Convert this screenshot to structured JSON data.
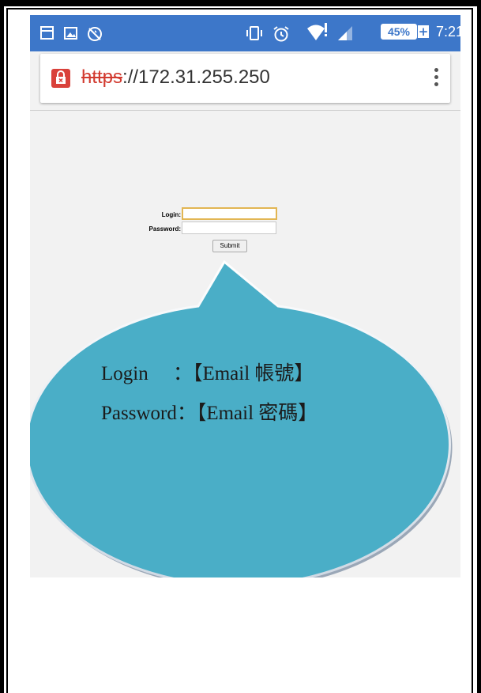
{
  "status_bar": {
    "battery_percent": "45%",
    "time": "7:21",
    "color": "#3d77c9",
    "icons": [
      "window-icon",
      "image-icon",
      "no-sync-icon",
      "vibrate-icon",
      "alarm-icon",
      "wifi-alert-icon",
      "signal-icon",
      "battery-icon",
      "charging-plus-icon"
    ]
  },
  "browser": {
    "url_scheme": "https",
    "url_rest": "://172.31.255.250",
    "security": "insecure-lock-icon",
    "menu": "overflow-menu-icon"
  },
  "login_form": {
    "login_label": "Login:",
    "password_label": "Password:",
    "login_value": "",
    "password_value": "",
    "submit_label": "Submit"
  },
  "callout": {
    "line1": "Login　  ：【Email 帳號】",
    "line2": "Password：【Email 密碼】",
    "fill_color": "#4aaec7"
  }
}
